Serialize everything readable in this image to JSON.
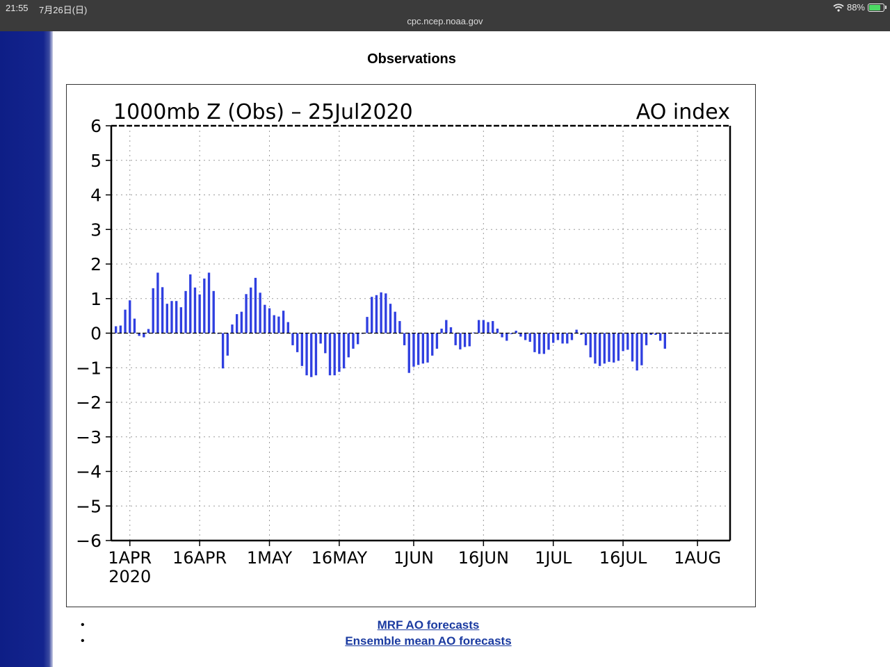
{
  "status_bar": {
    "time": "21:55",
    "date": "7月26日(日)",
    "url": "cpc.ncep.noaa.gov",
    "battery_percent": "88%",
    "battery_level": 0.88
  },
  "page": {
    "title": "Observations"
  },
  "chart_data": {
    "type": "bar",
    "title": "1000mb Z (Obs) – 25Jul2020",
    "title_right": "AO index",
    "ylim": [
      -6,
      6
    ],
    "yticks": [
      "6",
      "5",
      "4",
      "3",
      "2",
      "1",
      "0",
      "−1",
      "−2",
      "−3",
      "−4",
      "−5",
      "−6"
    ],
    "xticks": [
      {
        "date": "2020-04-01",
        "label": "1APR",
        "sublabel": "2020"
      },
      {
        "date": "2020-04-16",
        "label": "16APR"
      },
      {
        "date": "2020-05-01",
        "label": "1MAY"
      },
      {
        "date": "2020-05-16",
        "label": "16MAY"
      },
      {
        "date": "2020-06-01",
        "label": "1JUN"
      },
      {
        "date": "2020-06-16",
        "label": "16JUN"
      },
      {
        "date": "2020-07-01",
        "label": "1JUL"
      },
      {
        "date": "2020-07-16",
        "label": "16JUL"
      },
      {
        "date": "2020-08-01",
        "label": "1AUG"
      }
    ],
    "grid": true,
    "bar_color": "#2f3fe0",
    "x_start": "2020-03-28",
    "x_end": "2020-08-08",
    "series": [
      {
        "start_date": "2020-03-29",
        "values": [
          0.2,
          0.22,
          0.68,
          0.95,
          0.42,
          -0.08,
          -0.12,
          0.12,
          1.3,
          1.75,
          1.33,
          0.85,
          0.93,
          0.93,
          0.75,
          1.22,
          1.7,
          1.32,
          1.12,
          1.58,
          1.75,
          1.22,
          -0.02,
          -1.02,
          -0.65,
          0.25,
          0.55,
          0.62,
          1.13,
          1.32,
          1.6,
          1.17,
          0.82,
          0.72,
          0.52,
          0.48,
          0.65,
          0.32,
          -0.35,
          -0.55,
          -0.95,
          -1.22,
          -1.27,
          -1.22,
          -0.3,
          -0.58,
          -1.22,
          -1.22,
          -1.12,
          -1.02,
          -0.7,
          -0.45,
          -0.32,
          -0.02,
          0.47,
          1.05,
          1.1,
          1.18,
          1.15,
          0.85,
          0.62,
          0.35,
          -0.35,
          -1.15,
          -0.97,
          -0.92,
          -0.88,
          -0.85,
          -0.65,
          -0.45,
          0.13,
          0.38,
          0.17,
          -0.35,
          -0.47,
          -0.4,
          -0.38,
          0.02,
          0.38,
          0.38,
          0.32,
          0.35,
          0.13,
          -0.12,
          -0.22,
          -0.03,
          0.07,
          -0.1,
          -0.2,
          -0.25,
          -0.55,
          -0.6,
          -0.6,
          -0.48,
          -0.28,
          -0.2,
          -0.3,
          -0.3,
          -0.2,
          0.1,
          -0.05,
          -0.35,
          -0.7,
          -0.88,
          -0.95,
          -0.88,
          -0.83,
          -0.85,
          -0.8,
          -0.52,
          -0.48,
          -0.82,
          -1.08,
          -0.93,
          -0.35,
          -0.05,
          -0.05,
          -0.22,
          -0.45
        ]
      }
    ]
  },
  "links": [
    {
      "label": "MRF AO forecasts"
    },
    {
      "label": "Ensemble mean AO forecasts"
    }
  ]
}
